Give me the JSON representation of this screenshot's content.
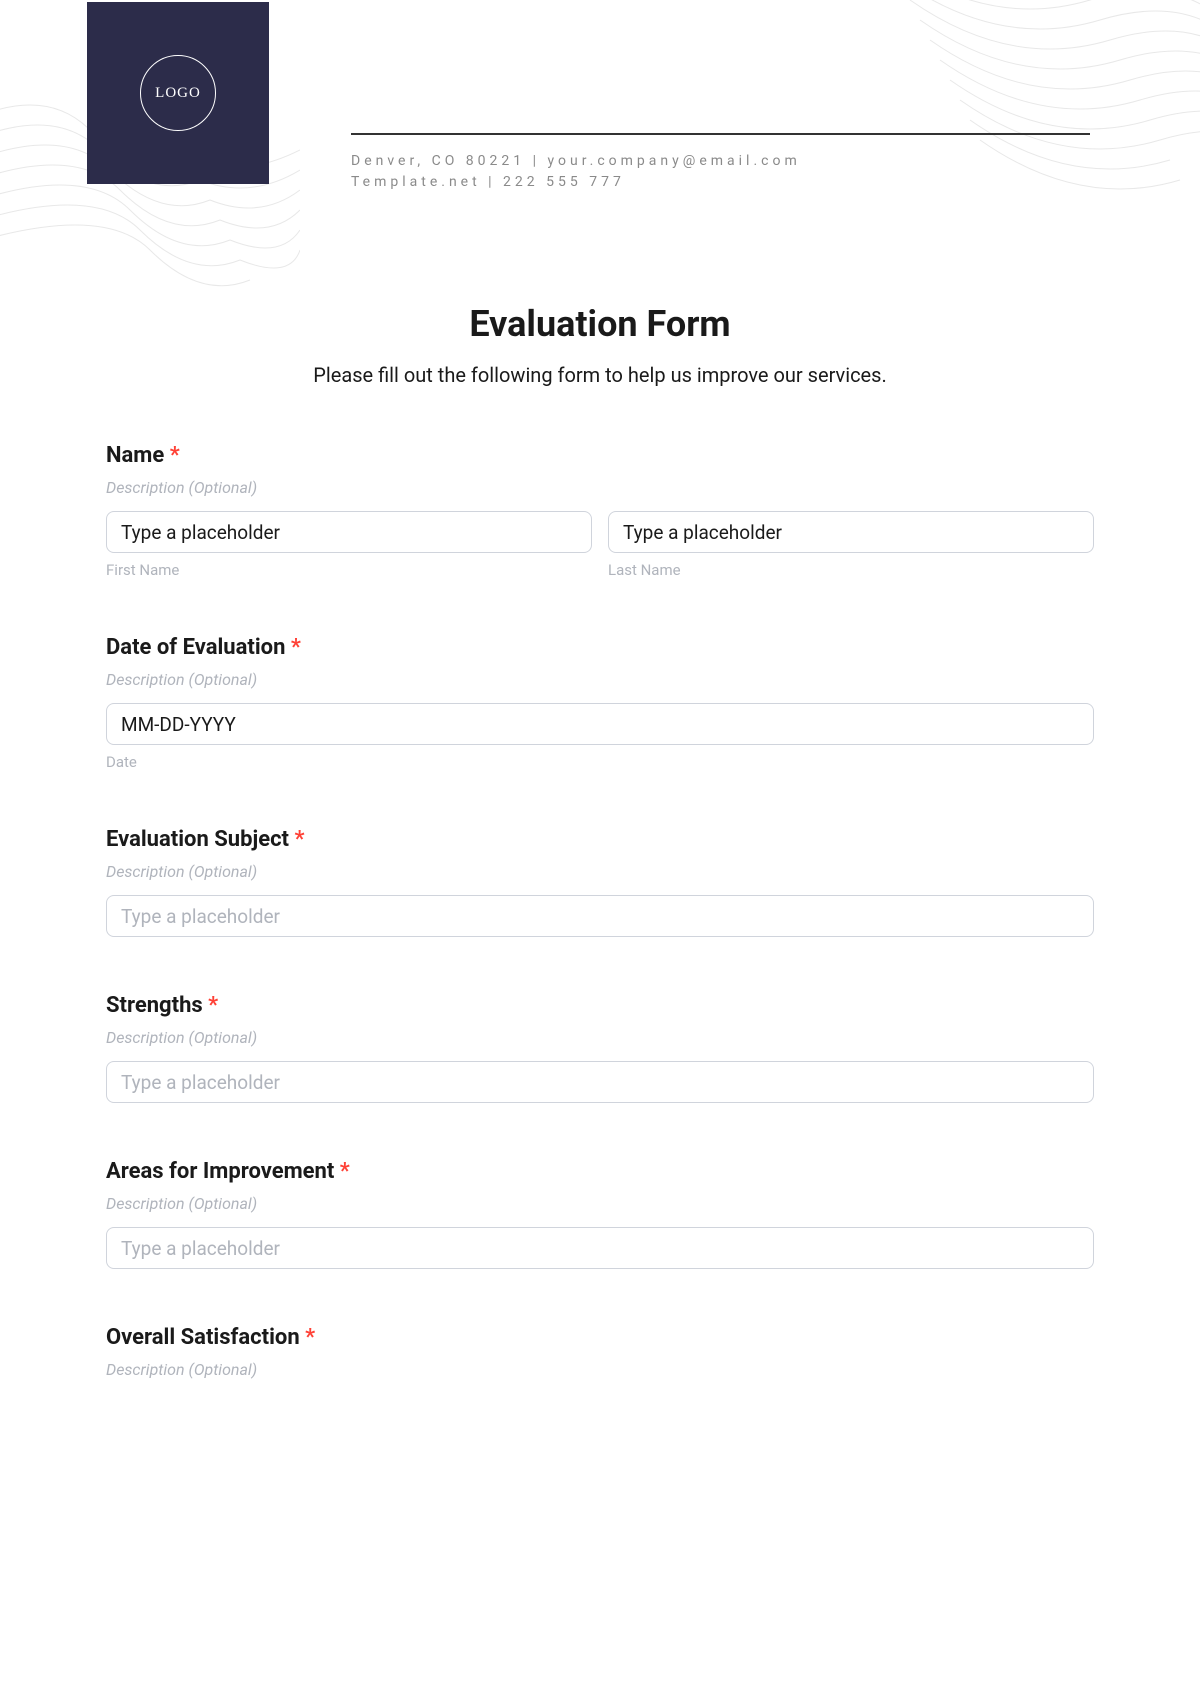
{
  "logo": {
    "text": "LOGO"
  },
  "company": {
    "line1": "Denver, CO 80221 | your.company@email.com",
    "line2": "Template.net | 222 555 777"
  },
  "form": {
    "title": "Evaluation Form",
    "subtitle": "Please fill out the following form to help us improve our services.",
    "required_mark": "*",
    "description_text": "Description (Optional)",
    "fields": {
      "name": {
        "label": "Name",
        "first_placeholder": "Type a placeholder",
        "last_placeholder": "Type a placeholder",
        "first_sublabel": "First Name",
        "last_sublabel": "Last Name"
      },
      "date": {
        "label": "Date of Evaluation",
        "placeholder": "MM-DD-YYYY",
        "sublabel": "Date"
      },
      "subject": {
        "label": "Evaluation Subject",
        "placeholder": "Type a placeholder"
      },
      "strengths": {
        "label": "Strengths",
        "placeholder": "Type a placeholder"
      },
      "improvement": {
        "label": "Areas for Improvement",
        "placeholder": "Type a placeholder"
      },
      "satisfaction": {
        "label": "Overall Satisfaction"
      }
    }
  }
}
